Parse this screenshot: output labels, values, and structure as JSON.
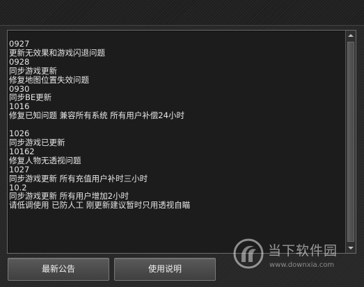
{
  "changelog": {
    "text": "0927\n更新无效果和游戏闪退问题\n0928\n同步游戏更新\n修复地图位置失效问题\n0930\n同步BE更新\n1016\n修复已知问题 兼容所有系统 所有用户补偿24小时\n\n1026\n同步游戏已更新\n10162\n修复人物无透视问题\n1027\n同步游戏更新 所有充值用户补时三小时\n10.2\n同步游戏更新 所有用户增加2小时\n请低调使用 已防人工 刚更新建议暂时只用透视自瞄"
  },
  "buttons": {
    "latest_notice": "最新公告",
    "usage_instructions": "使用说明"
  },
  "watermark": {
    "title": "当下软件园",
    "url": "www.downxia.com"
  }
}
